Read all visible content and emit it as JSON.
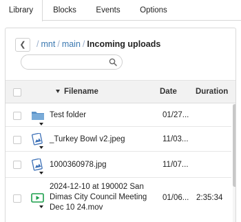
{
  "tabs": [
    {
      "label": "Library",
      "active": true
    },
    {
      "label": "Blocks",
      "active": false
    },
    {
      "label": "Events",
      "active": false
    },
    {
      "label": "Options",
      "active": false
    }
  ],
  "breadcrumb": {
    "back_icon": "chevron-left-icon",
    "links": [
      "mnt",
      "main"
    ],
    "separator": "/",
    "current": "Incoming uploads"
  },
  "search": {
    "placeholder": "",
    "value": "",
    "icon": "search-icon"
  },
  "table": {
    "headers": {
      "filename": "Filename",
      "date": "Date",
      "duration": "Duration"
    },
    "sort_column": "Filename",
    "rows": [
      {
        "type": "folder",
        "icon": "folder-icon",
        "name": "Test folder",
        "date": "01/27...",
        "duration": ""
      },
      {
        "type": "image",
        "icon": "image-file-icon",
        "name": "_Turkey Bowl v2.jpeg",
        "date": "11/03...",
        "duration": ""
      },
      {
        "type": "image",
        "icon": "image-file-icon",
        "name": "1000360978.jpg",
        "date": "11/07...",
        "duration": ""
      },
      {
        "type": "video",
        "icon": "video-file-icon",
        "name": "2024-12-10 at 190002 San Dimas City Council Meeting Dec 10 24.mov",
        "date": "01/06...",
        "duration": "2:35:34"
      }
    ]
  },
  "colors": {
    "link": "#3a78b0",
    "folder": "#5b93c8",
    "video": "#1a9e4a",
    "image": "#3b6fb6"
  }
}
